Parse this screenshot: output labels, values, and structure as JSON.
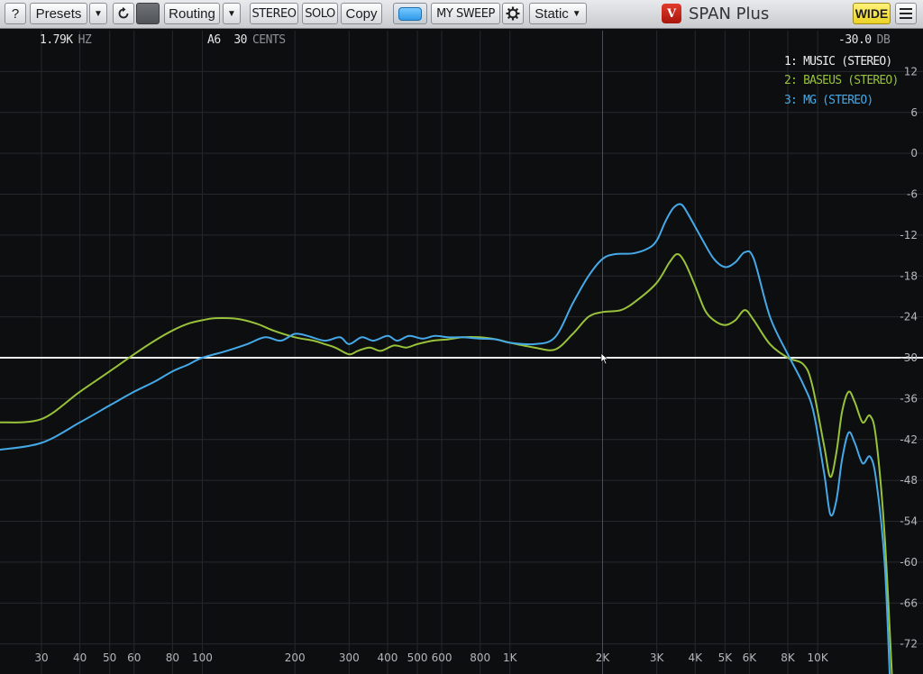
{
  "toolbar": {
    "help_label": "?",
    "presets_label": "Presets",
    "dropdown_arrow": "▼",
    "routing_label": "Routing",
    "stereo_label": "STEREO",
    "solo_label": "SOLO",
    "copy_label": "Copy",
    "sweep_label": "MY SWEEP",
    "mode_label": "Static",
    "wide_label": "WIDE",
    "brand_name": "SPAN Plus",
    "accent_color": "#3aa6f2",
    "wide_color": "#f3e03a"
  },
  "readouts": {
    "frequency_value": "1.79K",
    "frequency_unit": "HZ",
    "note_value": "A6",
    "cents_value": "30",
    "cents_unit": "CENTS",
    "level_value": "-30.0",
    "level_unit": "DB"
  },
  "chart_data": {
    "type": "line",
    "x_scale": "log",
    "x_unit": "Hz",
    "y_unit": "dB",
    "xlim": [
      22,
      22000
    ],
    "ylim": [
      -78,
      18
    ],
    "x_ticks": [
      30,
      40,
      50,
      60,
      80,
      100,
      200,
      300,
      400,
      500,
      600,
      800,
      1000,
      2000,
      3000,
      4000,
      5000,
      6000,
      8000,
      10000
    ],
    "x_tick_labels": [
      "30",
      "40",
      "50",
      "60",
      "80",
      "100",
      "200",
      "300",
      "400",
      "500",
      "600",
      "800",
      "1K",
      "2K",
      "3K",
      "4K",
      "5K",
      "6K",
      "8K",
      "10K"
    ],
    "y_ticks": [
      12,
      6,
      0,
      -6,
      -12,
      -18,
      -24,
      -30,
      -36,
      -42,
      -48,
      -54,
      -60,
      -66,
      -72
    ],
    "y_tick_labels": [
      "12",
      "6",
      "0",
      "-6",
      "-12",
      "-18",
      "-24",
      "-30",
      "-36",
      "-42",
      "-48",
      "-54",
      "-60",
      "-66",
      "-72"
    ],
    "grid": true,
    "legend_position": "top-right",
    "series": [
      {
        "name": "1: MUSIC (STEREO)",
        "color": "#eeeeee",
        "points": [
          [
            22,
            -30.0
          ],
          [
            22000,
            -30.0
          ]
        ]
      },
      {
        "name": "2: BASEUS (STEREO)",
        "color": "#98c23a",
        "points": [
          [
            22,
            -39.5
          ],
          [
            30,
            -39.0
          ],
          [
            40,
            -35.0
          ],
          [
            50,
            -32.0
          ],
          [
            60,
            -29.5
          ],
          [
            70,
            -27.5
          ],
          [
            80,
            -26.0
          ],
          [
            90,
            -25.0
          ],
          [
            100,
            -24.5
          ],
          [
            110,
            -24.2
          ],
          [
            130,
            -24.3
          ],
          [
            150,
            -25.0
          ],
          [
            170,
            -26.0
          ],
          [
            200,
            -27.0
          ],
          [
            230,
            -27.5
          ],
          [
            250,
            -28.0
          ],
          [
            270,
            -28.5
          ],
          [
            300,
            -29.5
          ],
          [
            320,
            -29.0
          ],
          [
            350,
            -28.5
          ],
          [
            380,
            -29.0
          ],
          [
            420,
            -28.2
          ],
          [
            460,
            -28.5
          ],
          [
            500,
            -28.0
          ],
          [
            560,
            -27.5
          ],
          [
            630,
            -27.3
          ],
          [
            700,
            -27.0
          ],
          [
            800,
            -27.0
          ],
          [
            900,
            -27.3
          ],
          [
            1000,
            -27.8
          ],
          [
            1200,
            -28.5
          ],
          [
            1400,
            -28.8
          ],
          [
            1600,
            -26.5
          ],
          [
            1800,
            -24.0
          ],
          [
            2000,
            -23.3
          ],
          [
            2300,
            -23.0
          ],
          [
            2600,
            -21.5
          ],
          [
            3000,
            -19.0
          ],
          [
            3300,
            -16.0
          ],
          [
            3500,
            -14.8
          ],
          [
            3700,
            -16.0
          ],
          [
            4000,
            -19.5
          ],
          [
            4300,
            -23.0
          ],
          [
            4600,
            -24.5
          ],
          [
            5000,
            -25.2
          ],
          [
            5400,
            -24.5
          ],
          [
            5800,
            -23.0
          ],
          [
            6200,
            -24.5
          ],
          [
            7000,
            -28.0
          ],
          [
            8000,
            -30.0
          ],
          [
            9000,
            -31.0
          ],
          [
            9600,
            -34.0
          ],
          [
            10500,
            -43.0
          ],
          [
            11000,
            -47.5
          ],
          [
            11500,
            -44.0
          ],
          [
            12000,
            -38.0
          ],
          [
            12600,
            -35.0
          ],
          [
            13200,
            -36.5
          ],
          [
            14000,
            -39.5
          ],
          [
            14800,
            -38.5
          ],
          [
            15500,
            -42.0
          ],
          [
            16500,
            -56.0
          ],
          [
            17500,
            -78.0
          ]
        ]
      },
      {
        "name": "3: MG (STEREO)",
        "color": "#45a9e8",
        "points": [
          [
            22,
            -43.5
          ],
          [
            30,
            -42.5
          ],
          [
            40,
            -39.5
          ],
          [
            50,
            -37.0
          ],
          [
            60,
            -35.0
          ],
          [
            70,
            -33.5
          ],
          [
            80,
            -32.0
          ],
          [
            90,
            -31.0
          ],
          [
            100,
            -30.0
          ],
          [
            120,
            -29.0
          ],
          [
            140,
            -28.0
          ],
          [
            160,
            -27.0
          ],
          [
            180,
            -27.5
          ],
          [
            200,
            -26.5
          ],
          [
            220,
            -26.8
          ],
          [
            250,
            -27.5
          ],
          [
            280,
            -27.0
          ],
          [
            300,
            -28.0
          ],
          [
            330,
            -27.0
          ],
          [
            360,
            -27.5
          ],
          [
            400,
            -26.8
          ],
          [
            430,
            -27.5
          ],
          [
            470,
            -26.8
          ],
          [
            520,
            -27.2
          ],
          [
            570,
            -26.8
          ],
          [
            630,
            -27.0
          ],
          [
            700,
            -27.0
          ],
          [
            800,
            -27.2
          ],
          [
            900,
            -27.3
          ],
          [
            1000,
            -27.8
          ],
          [
            1200,
            -28.0
          ],
          [
            1400,
            -27.0
          ],
          [
            1600,
            -22.0
          ],
          [
            1800,
            -18.0
          ],
          [
            2000,
            -15.5
          ],
          [
            2200,
            -14.8
          ],
          [
            2500,
            -14.7
          ],
          [
            2800,
            -14.0
          ],
          [
            3000,
            -12.8
          ],
          [
            3200,
            -10.0
          ],
          [
            3400,
            -8.0
          ],
          [
            3600,
            -7.5
          ],
          [
            3800,
            -9.0
          ],
          [
            4200,
            -12.5
          ],
          [
            4600,
            -15.5
          ],
          [
            5000,
            -16.7
          ],
          [
            5400,
            -16.0
          ],
          [
            5800,
            -14.5
          ],
          [
            6200,
            -15.5
          ],
          [
            7000,
            -24.0
          ],
          [
            8000,
            -29.5
          ],
          [
            9000,
            -34.0
          ],
          [
            9700,
            -38.0
          ],
          [
            10500,
            -47.0
          ],
          [
            11000,
            -53.0
          ],
          [
            11500,
            -51.0
          ],
          [
            12000,
            -45.0
          ],
          [
            12600,
            -41.0
          ],
          [
            13200,
            -42.5
          ],
          [
            14000,
            -45.5
          ],
          [
            14800,
            -44.5
          ],
          [
            15500,
            -48.0
          ],
          [
            16500,
            -60.0
          ],
          [
            17200,
            -78.0
          ]
        ]
      }
    ]
  }
}
